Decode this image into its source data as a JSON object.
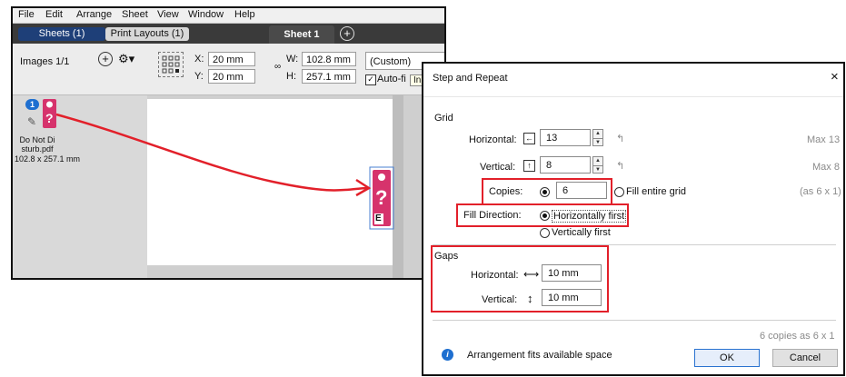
{
  "menu": [
    "File",
    "Edit",
    "Arrange",
    "Sheet",
    "View",
    "Window",
    "Help"
  ],
  "tabs": {
    "sheets": "Sheets (1)",
    "print_layouts": "Print Layouts (1)",
    "sheet": "Sheet 1",
    "add": "+"
  },
  "toolbar": {
    "images_label": "Images 1/1",
    "x_label": "X:",
    "x_value": "20 mm",
    "y_label": "Y:",
    "y_value": "20 mm",
    "w_label": "W:",
    "w_value": "102.8 mm",
    "h_label": "H:",
    "h_value": "257.1 mm",
    "preset": "(Custom)",
    "autofit": "Auto-fi",
    "tooltip": "In"
  },
  "image": {
    "badge": "1",
    "name": "Do Not Di sturb.pdf",
    "size": "102.8 x 257.1 mm",
    "thumb_letter": "E"
  },
  "dialog": {
    "title": "Step and Repeat",
    "close": "×",
    "grid_label": "Grid",
    "horizontal_label": "Horizontal:",
    "horizontal_value": "13",
    "horizontal_max": "Max 13",
    "vertical_label": "Vertical:",
    "vertical_value": "8",
    "vertical_max": "Max 8",
    "copies_label": "Copies:",
    "copies_value": "6",
    "fill_grid_label": "Fill entire grid",
    "copies_note": "(as 6 x 1)",
    "fill_direction_label": "Fill Direction:",
    "horiz_first": "Horizontally first",
    "vert_first": "Vertically first",
    "gaps_label": "Gaps",
    "gap_h_label": "Horizontal:",
    "gap_h_value": "10 mm",
    "gap_v_label": "Vertical:",
    "gap_v_value": "10 mm",
    "summary": "6 copies as 6 x 1",
    "status": "Arrangement fits available space",
    "ok": "OK",
    "cancel": "Cancel"
  },
  "colors": {
    "accent_red": "#e2202a",
    "tab_blue": "#1e3f78",
    "info_blue": "#1e6fd0",
    "thumb_pink": "#d6336c"
  }
}
